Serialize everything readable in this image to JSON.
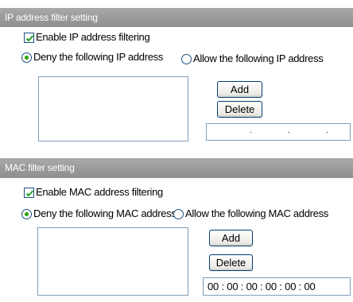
{
  "ip_section": {
    "title": "IP address filter setting",
    "enable_label": "Enable IP address filtering",
    "enable_checked": true,
    "deny_label": "Deny the following IP address",
    "allow_label": "Allow the following IP address",
    "selected_mode": "deny",
    "add_label": "Add",
    "delete_label": "Delete",
    "ip_separators": [
      ".",
      ".",
      "."
    ]
  },
  "mac_section": {
    "title": "MAC filter setting",
    "enable_label": "Enable MAC address filtering",
    "enable_checked": true,
    "deny_label": "Deny the following MAC address",
    "allow_label": "Allow the following MAC address",
    "selected_mode": "deny",
    "add_label": "Add",
    "delete_label": "Delete",
    "mac_value": "00 : 00 : 00 : 00 : 00 : 00"
  }
}
